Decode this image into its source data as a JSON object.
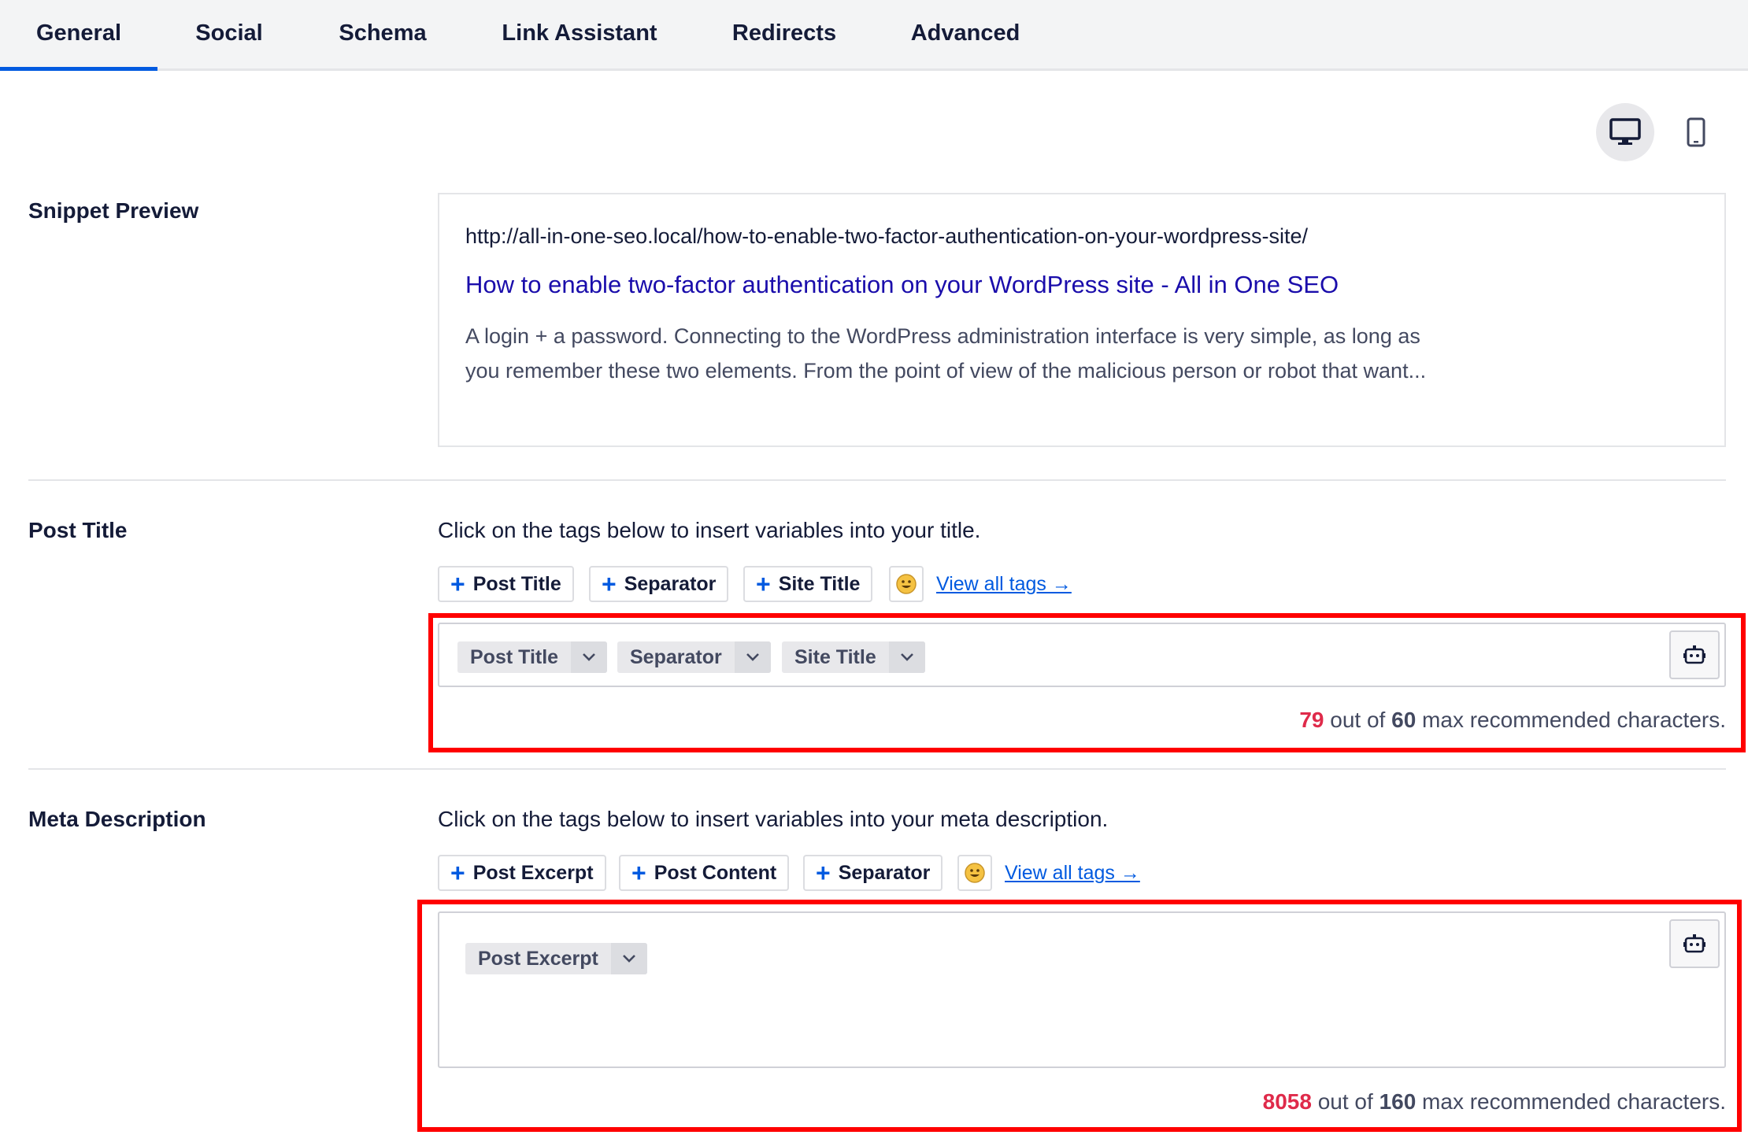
{
  "tabs": [
    {
      "label": "General",
      "active": true
    },
    {
      "label": "Social",
      "active": false
    },
    {
      "label": "Schema",
      "active": false
    },
    {
      "label": "Link Assistant",
      "active": false
    },
    {
      "label": "Redirects",
      "active": false
    },
    {
      "label": "Advanced",
      "active": false
    }
  ],
  "device_toggle": {
    "selected": "desktop",
    "icons": [
      "desktop-icon",
      "mobile-icon"
    ]
  },
  "snippet": {
    "label": "Snippet Preview",
    "url": "http://all-in-one-seo.local/how-to-enable-two-factor-authentication-on-your-wordpress-site/",
    "title": "How to enable two-factor authentication on your WordPress site - All in One SEO",
    "description": "A login + a password. Connecting to the WordPress administration interface is very simple, as long as you remember these two elements. From the point of view of the malicious person or robot that want..."
  },
  "post_title": {
    "label": "Post Title",
    "hint": "Click on the tags below to insert variables into your title.",
    "tag_buttons": [
      "Post Title",
      "Separator",
      "Site Title"
    ],
    "view_all": "View all tags →",
    "chips": [
      "Post Title",
      "Separator",
      "Site Title"
    ],
    "count": {
      "current": "79",
      "middle": " out of ",
      "max": "60",
      "suffix": " max recommended characters."
    }
  },
  "meta_description": {
    "label": "Meta Description",
    "hint": "Click on the tags below to insert variables into your meta description.",
    "tag_buttons": [
      "Post Excerpt",
      "Post Content",
      "Separator"
    ],
    "view_all": "View all tags →",
    "chips": [
      "Post Excerpt"
    ],
    "count": {
      "current": "8058",
      "middle": " out of ",
      "max": "160",
      "suffix": " max recommended characters."
    }
  },
  "colors": {
    "accent": "#005ae0",
    "over_limit": "#df2a4a",
    "highlight": "#ff0000",
    "link_title": "#1a0dab"
  }
}
